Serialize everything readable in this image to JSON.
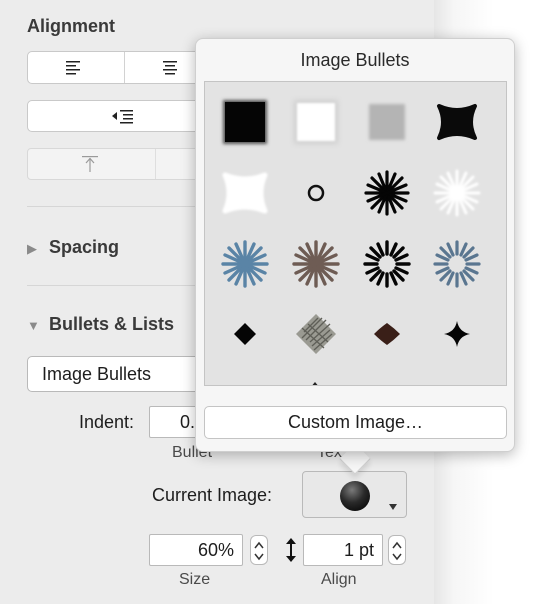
{
  "alignment": {
    "title": "Alignment"
  },
  "spacing": {
    "title": "Spacing"
  },
  "bullets": {
    "title": "Bullets & Lists",
    "style_value": "Image Bullets",
    "indent_label": "Indent:",
    "indent_value": "0.",
    "bullet_sublabel": "Bullet",
    "text_sublabel": "Tex",
    "current_image_label": "Current Image:",
    "size_value": "60%",
    "size_label": "Size",
    "align_value": "1 pt",
    "align_label": "Align"
  },
  "popover": {
    "title": "Image Bullets",
    "custom_button": "Custom Image…",
    "images": [
      {
        "name": "black-square"
      },
      {
        "name": "white-square"
      },
      {
        "name": "gray-square"
      },
      {
        "name": "black-rounded-star"
      },
      {
        "name": "white-rounded-star"
      },
      {
        "name": "small-ring"
      },
      {
        "name": "black-starburst"
      },
      {
        "name": "white-starburst"
      },
      {
        "name": "blue-starburst"
      },
      {
        "name": "brown-starburst"
      },
      {
        "name": "black-sunburst"
      },
      {
        "name": "blue-sunburst"
      },
      {
        "name": "black-diamond"
      },
      {
        "name": "sketch-diamond"
      },
      {
        "name": "brown-diamond"
      },
      {
        "name": "black-four-point-star"
      }
    ]
  },
  "colors": {
    "panel": "#ececec",
    "popover": "#f6f6f6",
    "steel_blue": "#5a84a6",
    "brown": "#6e5c54"
  }
}
